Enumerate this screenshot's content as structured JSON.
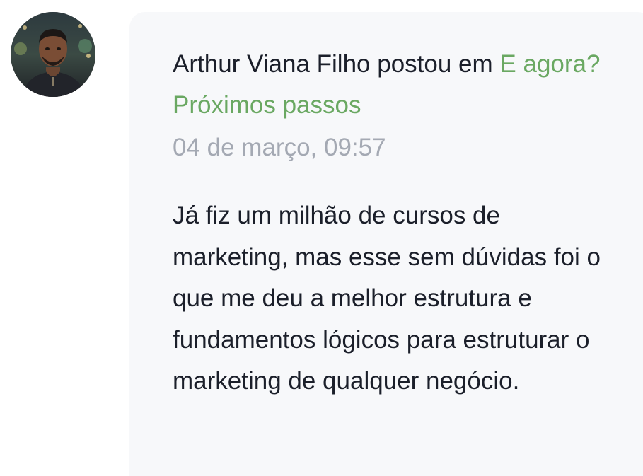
{
  "post": {
    "author": "Arthur Viana Filho",
    "action": "postou em",
    "space_link": "E agora? Próximos passos",
    "timestamp": "04 de março, 09:57",
    "body": "Já fiz um milhão de cursos de marketing, mas esse sem dúvidas foi o que me deu a melhor estrutura e fundamentos lógicos para estruturar o marketing de qualquer negócio."
  },
  "colors": {
    "link": "#6aa862",
    "text": "#1b1f2a",
    "muted": "#a4a9b3",
    "bubble": "#f7f8fa"
  },
  "icons": {
    "avatar": "user-avatar-photo"
  }
}
